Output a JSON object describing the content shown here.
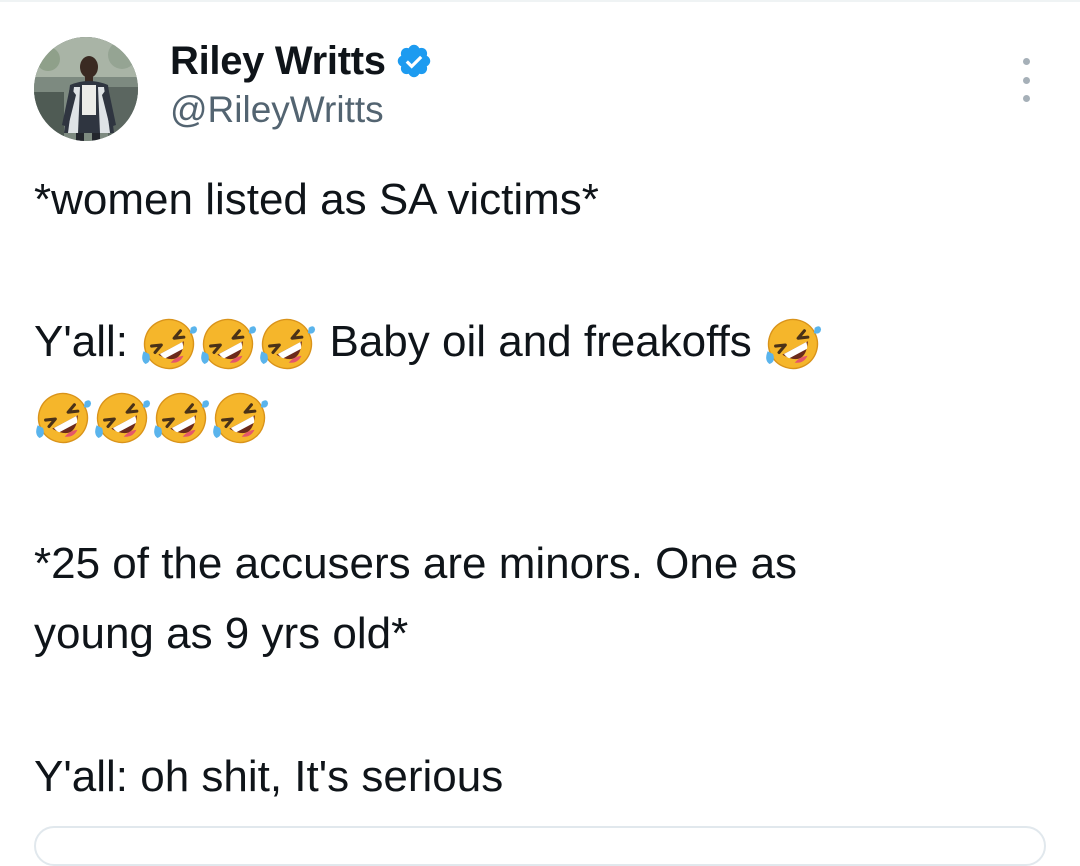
{
  "tweet": {
    "author": {
      "display_name": "Riley Writts",
      "handle": "@RileyWritts",
      "verified": true,
      "avatar": "user-photo"
    },
    "more_icon": "more-dots-icon",
    "lines": {
      "line1": "*women listed as SA victims*",
      "line2_prefix": "Y'all:",
      "line2_middle": "Baby oil and freakoffs",
      "line3": "*25 of the accusers are minors. One as",
      "line4": "young as 9 yrs old*",
      "line5": "Y'all: oh shit, It's serious"
    },
    "emoji": "rolling-on-the-floor-laughing"
  },
  "colors": {
    "text": "#0f1419",
    "secondary": "#536471",
    "verified_blue": "#1d9bf0",
    "emoji_face": "#f5b62b",
    "divider": "#eff3f4"
  }
}
